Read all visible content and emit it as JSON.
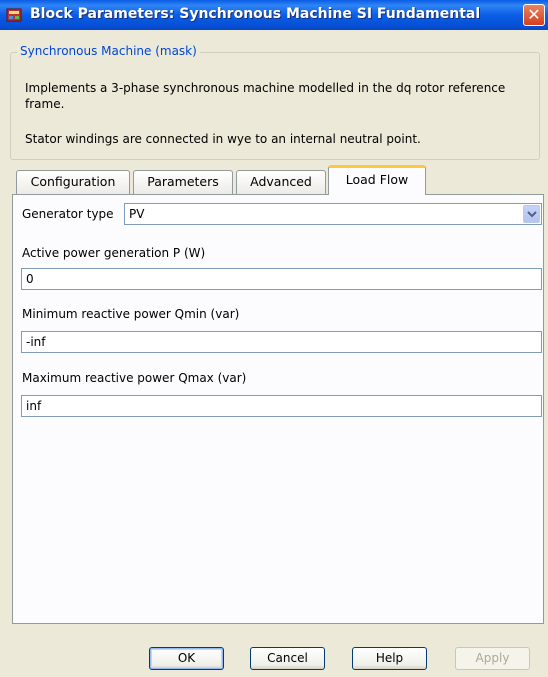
{
  "window": {
    "title": "Block Parameters: Synchronous Machine SI Fundamental",
    "close_symbol": "✕",
    "colors": {
      "titlebar": "#0a5ce4",
      "group_title": "#0046d5",
      "active_tab_highlight": "#ffc83c"
    }
  },
  "mask": {
    "group_title": "Synchronous Machine (mask)",
    "description_1": "Implements a 3-phase synchronous machine modelled in the dq rotor reference frame.",
    "description_2": "Stator windings are connected in wye to an internal neutral point."
  },
  "tabs": [
    {
      "label": "Configuration",
      "active": false
    },
    {
      "label": "Parameters",
      "active": false
    },
    {
      "label": "Advanced",
      "active": false
    },
    {
      "label": "Load Flow",
      "active": true
    }
  ],
  "load_flow": {
    "generator_type": {
      "label": "Generator type",
      "value": "PV"
    },
    "active_power": {
      "label": "Active power generation P (W)",
      "value": "0"
    },
    "qmin": {
      "label": "Minimum reactive power Qmin (var)",
      "value": "-inf"
    },
    "qmax": {
      "label": "Maximum reactive power Qmax (var)",
      "value": "inf"
    }
  },
  "buttons": {
    "ok": "OK",
    "cancel": "Cancel",
    "help": "Help",
    "apply": "Apply"
  },
  "icons": {
    "app": "simulink-block-icon",
    "dropdown": "chevron-down-icon"
  }
}
